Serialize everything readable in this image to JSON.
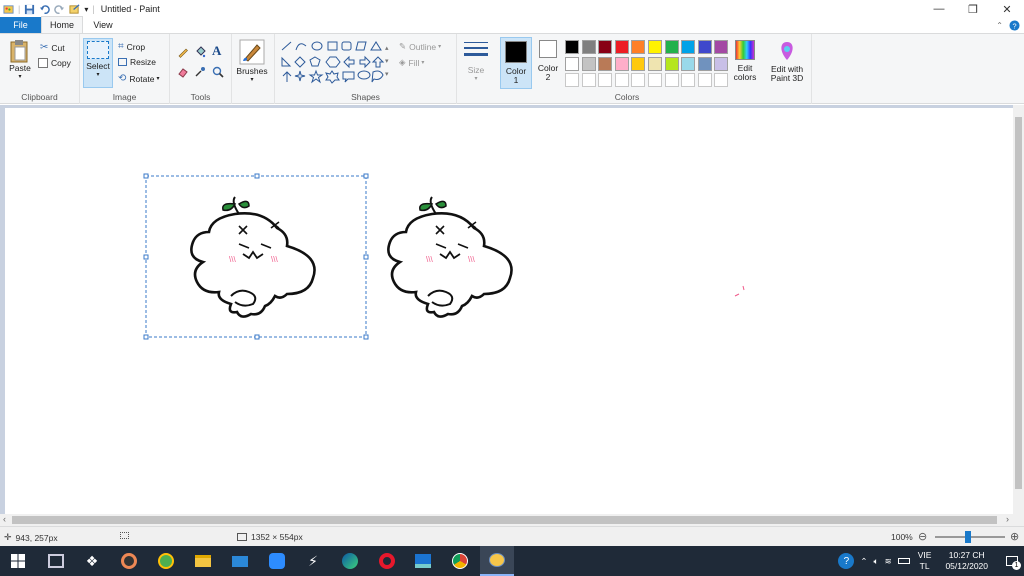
{
  "window": {
    "title": "Untitled - Paint",
    "minimize_glyph": "—",
    "restore_glyph": "❐",
    "close_glyph": "✕"
  },
  "tabs": {
    "file": "File",
    "home": "Home",
    "view": "View"
  },
  "ribbon": {
    "clipboard": {
      "label": "Clipboard",
      "paste": "Paste",
      "cut": "Cut",
      "copy": "Copy"
    },
    "image": {
      "label": "Image",
      "select": "Select",
      "crop": "Crop",
      "resize": "Resize",
      "rotate": "Rotate"
    },
    "tools": {
      "label": "Tools"
    },
    "brushes": {
      "label": "Brushes"
    },
    "shapes": {
      "label": "Shapes",
      "outline": "Outline",
      "fill": "Fill"
    },
    "size": {
      "label": "Size"
    },
    "color1": {
      "label": "Color",
      "num": "1",
      "color": "#000000"
    },
    "color2": {
      "label": "Color",
      "num": "2",
      "color": "#ffffff"
    },
    "colors": {
      "label": "Colors",
      "edit": "Edit",
      "edit2": "colors",
      "paint3d": "Edit with",
      "paint3d2": "Paint 3D",
      "row1": [
        "#000000",
        "#7f7f7f",
        "#880015",
        "#ed1c24",
        "#ff7f27",
        "#fff200",
        "#22b14c",
        "#00a2e8",
        "#3f48cc",
        "#a349a4"
      ],
      "row2": [
        "#ffffff",
        "#c3c3c3",
        "#b97a57",
        "#ffaec9",
        "#ffc90e",
        "#efe4b0",
        "#b5e61d",
        "#99d9ea",
        "#7092be",
        "#c8bfe7"
      ],
      "row3": [
        "#ffffff",
        "#ffffff",
        "#ffffff",
        "#ffffff",
        "#ffffff",
        "#ffffff",
        "#ffffff",
        "#ffffff",
        "#ffffff",
        "#ffffff"
      ]
    }
  },
  "status": {
    "cursor_pos": "943, 257px",
    "canvas_size": "1352 × 554px",
    "zoom": "100%"
  },
  "taskbar": {
    "lang1": "VIE",
    "lang2": "TL",
    "time": "10:27 CH",
    "date": "05/12/2020",
    "notif_count": "1"
  }
}
